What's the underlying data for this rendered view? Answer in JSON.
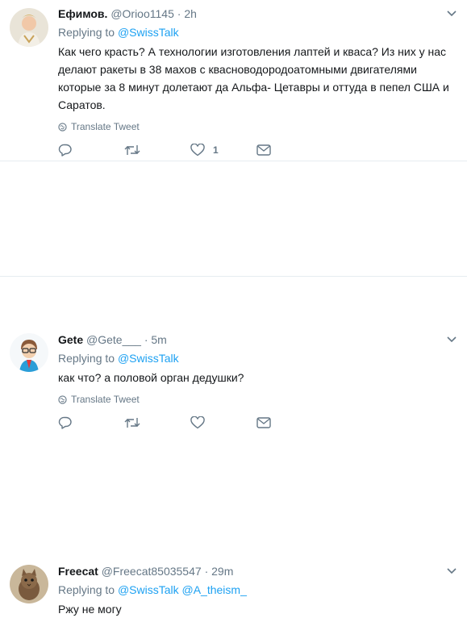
{
  "tweets": [
    {
      "name": "Ефимов.",
      "handle": "@Orioo1145",
      "dot": "·",
      "time": "2h",
      "replying_prefix": "Replying to",
      "replying_to": "@SwissTalk",
      "text": "Как чего красть? А технологии изготовления лаптей и кваса? Из них у нас делают ракеты в 38 махов с квасноводородоатомными двигателями которые за 8 минут долетают да Альфа- Цетавры и оттуда в пепел США и Саратов.",
      "translate": "Translate Tweet",
      "like_count": "1"
    },
    {
      "name": "Gete",
      "handle": "@Gete___",
      "dot": "·",
      "time": "5m",
      "replying_prefix": "Replying to",
      "replying_to": "@SwissTalk",
      "text": "как что? а половой орган дедушки?",
      "translate": "Translate Tweet",
      "like_count": ""
    },
    {
      "name": "Freecat",
      "handle": "@Freecat85035547",
      "dot": "·",
      "time": "29m",
      "replying_prefix": "Replying to",
      "replying_to": "@SwissTalk",
      "replying_to_2": "@A_theism_",
      "text": "Ржу не могу"
    }
  ],
  "icons": {
    "reply": "reply-icon",
    "retweet": "retweet-icon",
    "like": "heart-icon",
    "dm": "envelope-icon",
    "caret": "chevron-down-icon",
    "translate": "globe-icon"
  },
  "colors": {
    "link": "#1da1f2",
    "muted": "#657786",
    "text": "#14171a",
    "divider": "#e6ecf0"
  }
}
